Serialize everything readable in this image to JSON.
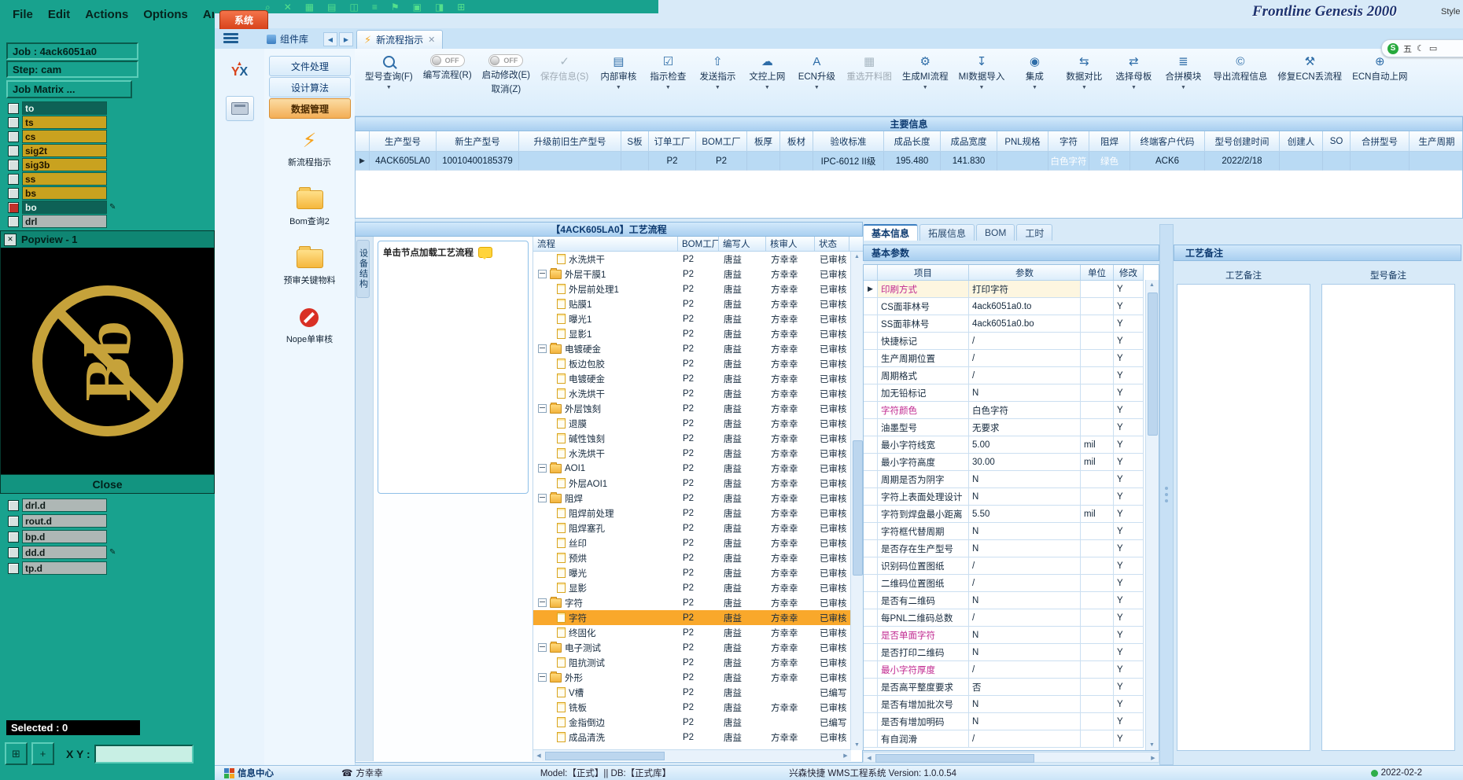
{
  "cam": {
    "menu": [
      "File",
      "Edit",
      "Actions",
      "Options",
      "Anal"
    ],
    "top_icons": [
      "zoom-icon",
      "close-icon",
      "grid-icon",
      "save-icon",
      "cells-icon",
      "list-icon",
      "flag-icon",
      "board-icon",
      "film-icon",
      "measure-icon"
    ],
    "job_label": "Job : 4ack6051a0",
    "step_label": "Step: cam",
    "job_matrix_label": "Job Matrix ...",
    "layers_top": [
      {
        "name": "to",
        "tone": "dark"
      },
      {
        "name": "ts",
        "tone": "gold"
      },
      {
        "name": "cs",
        "tone": "gold"
      },
      {
        "name": "sig2t",
        "tone": "gold"
      },
      {
        "name": "sig3b",
        "tone": "gold"
      },
      {
        "name": "ss",
        "tone": "gold"
      },
      {
        "name": "bs",
        "tone": "gold"
      },
      {
        "name": "bo",
        "tone": "dark",
        "marker": "red",
        "edited": true
      },
      {
        "name": "drl",
        "tone": "gray"
      }
    ],
    "layers_bottom": [
      {
        "name": "drl.d",
        "tone": "gray"
      },
      {
        "name": "rout.d",
        "tone": "gray"
      },
      {
        "name": "bp.d",
        "tone": "gray"
      },
      {
        "name": "dd.d",
        "tone": "gray",
        "edited": true
      },
      {
        "name": "tp.d",
        "tone": "gray"
      }
    ],
    "popview": {
      "title": "Popview - 1",
      "symbol_text": "Bb",
      "close_label": "Close"
    },
    "selected_label": "Selected : 0",
    "coord_label": "X Y :",
    "coord_value": ""
  },
  "desktop": {
    "genesis_title": "Frontline Genesis 2000",
    "style_label": "Style",
    "ime": {
      "logo_text": "S",
      "mode_text": "五"
    }
  },
  "app": {
    "system_tab": "系统",
    "tabbar": {
      "component_lib": "组件库",
      "active_tab": "新流程指示"
    },
    "sidebar": {
      "yx_logo_text": "YX",
      "buttons": [
        "文件处理",
        "设计算法",
        "数据管理"
      ],
      "active_index": 2,
      "shortcuts": [
        {
          "label": "新流程指示",
          "icon": "flow-bolt-icon"
        },
        {
          "label": "Bom查询2",
          "icon": "folder-icon"
        },
        {
          "label": "预审关键物料",
          "icon": "folder-icon"
        },
        {
          "label": "Nope单审核",
          "icon": "nope-audit-icon"
        }
      ]
    },
    "toolbar": {
      "buttons": [
        {
          "label": "型号查询(F)",
          "icon": "search-icon",
          "caret": true
        },
        {
          "label": "编写流程(R)",
          "icon": "toggle-off-switch",
          "toggle": "OFF"
        },
        {
          "label": "启动修改(E)",
          "sub": "取消(Z)",
          "icon": "toggle-off-switch",
          "toggle": "OFF"
        },
        {
          "label": "保存信息(S)",
          "icon": "save-check-icon",
          "disabled": true
        },
        {
          "label": "内部审核",
          "icon": "print-icon",
          "caret": true
        },
        {
          "label": "指示检查",
          "icon": "check-list-icon",
          "caret": true
        },
        {
          "label": "发送指示",
          "icon": "send-icon",
          "caret": true
        },
        {
          "label": "文控上网",
          "icon": "cloud-upload-icon",
          "caret": true
        },
        {
          "label": "ECN升级",
          "icon": "font-icon",
          "caret": true
        },
        {
          "label": "重选开料图",
          "icon": "image-icon",
          "disabled": true
        },
        {
          "label": "生成MI流程",
          "icon": "gears-icon",
          "caret": true
        },
        {
          "label": "MI数据导入",
          "icon": "import-icon",
          "caret": true
        },
        {
          "label": "集成",
          "icon": "integrate-icon",
          "caret": true
        },
        {
          "label": "数据对比",
          "icon": "compare-icon",
          "caret": true
        },
        {
          "label": "选择母板",
          "icon": "shuffle-icon",
          "caret": true
        },
        {
          "label": "合拼模块",
          "icon": "module-list-icon",
          "caret": true
        },
        {
          "label": "导出流程信息",
          "icon": "export-icon"
        },
        {
          "label": "修复ECN丢流程",
          "icon": "repair-icon"
        },
        {
          "label": "ECN自动上网",
          "icon": "auto-upload-icon"
        }
      ]
    },
    "main_info": {
      "title": "主要信息",
      "headers": [
        "生产型号",
        "新生产型号",
        "升级前旧生产型号",
        "S板",
        "订单工厂",
        "BOM工厂",
        "板厚",
        "板材",
        "验收标准",
        "成品长度",
        "成品宽度",
        "PNL规格",
        "字符",
        "阻焊",
        "终端客户代码",
        "型号创建时间",
        "创建人",
        "SO",
        "合拼型号",
        "生产周期"
      ],
      "row": [
        "4ACK605LA0",
        "10010400185379",
        "",
        "",
        "P2",
        "P2",
        "",
        "",
        "IPC-6012 II级",
        "195.480",
        "141.830",
        "",
        "白色字符",
        "绿色",
        "ACK6",
        "2022/2/18",
        "",
        "",
        "",
        ""
      ]
    },
    "flow": {
      "title": "【4ACK605LA0】工艺流程",
      "device_tab": "设备结构",
      "hint": "单击节点加载工艺流程",
      "headers": [
        "流程",
        "BOM工厂",
        "编写人",
        "核审人",
        "状态"
      ],
      "rows": [
        {
          "name": "水洗烘干",
          "type": "leaf",
          "bom": "P2",
          "writer": "唐益",
          "reviewer": "方幸幸",
          "status": "已审核"
        },
        {
          "name": "外层干膜1",
          "type": "folder",
          "bom": "P2",
          "writer": "唐益",
          "reviewer": "方幸幸",
          "status": "已审核"
        },
        {
          "name": "外层前处理1",
          "type": "leaf",
          "bom": "P2",
          "writer": "唐益",
          "reviewer": "方幸幸",
          "status": "已审核"
        },
        {
          "name": "贴膜1",
          "type": "leaf",
          "bom": "P2",
          "writer": "唐益",
          "reviewer": "方幸幸",
          "status": "已审核"
        },
        {
          "name": "曝光1",
          "type": "leaf",
          "bom": "P2",
          "writer": "唐益",
          "reviewer": "方幸幸",
          "status": "已审核"
        },
        {
          "name": "显影1",
          "type": "leaf",
          "bom": "P2",
          "writer": "唐益",
          "reviewer": "方幸幸",
          "status": "已审核"
        },
        {
          "name": "电镀硬金",
          "type": "folder",
          "bom": "P2",
          "writer": "唐益",
          "reviewer": "方幸幸",
          "status": "已审核"
        },
        {
          "name": "板边包胶",
          "type": "leaf",
          "bom": "P2",
          "writer": "唐益",
          "reviewer": "方幸幸",
          "status": "已审核"
        },
        {
          "name": "电镀硬金",
          "type": "leaf",
          "bom": "P2",
          "writer": "唐益",
          "reviewer": "方幸幸",
          "status": "已审核"
        },
        {
          "name": "水洗烘干",
          "type": "leaf",
          "bom": "P2",
          "writer": "唐益",
          "reviewer": "方幸幸",
          "status": "已审核"
        },
        {
          "name": "外层蚀刻",
          "type": "folder",
          "bom": "P2",
          "writer": "唐益",
          "reviewer": "方幸幸",
          "status": "已审核"
        },
        {
          "name": "退膜",
          "type": "leaf",
          "bom": "P2",
          "writer": "唐益",
          "reviewer": "方幸幸",
          "status": "已审核"
        },
        {
          "name": "碱性蚀刻",
          "type": "leaf",
          "bom": "P2",
          "writer": "唐益",
          "reviewer": "方幸幸",
          "status": "已审核"
        },
        {
          "name": "水洗烘干",
          "type": "leaf",
          "bom": "P2",
          "writer": "唐益",
          "reviewer": "方幸幸",
          "status": "已审核"
        },
        {
          "name": "AOI1",
          "type": "folder",
          "bom": "P2",
          "writer": "唐益",
          "reviewer": "方幸幸",
          "status": "已审核"
        },
        {
          "name": "外层AOI1",
          "type": "leaf",
          "bom": "P2",
          "writer": "唐益",
          "reviewer": "方幸幸",
          "status": "已审核"
        },
        {
          "name": "阻焊",
          "type": "folder",
          "bom": "P2",
          "writer": "唐益",
          "reviewer": "方幸幸",
          "status": "已审核"
        },
        {
          "name": "阻焊前处理",
          "type": "leaf",
          "bom": "P2",
          "writer": "唐益",
          "reviewer": "方幸幸",
          "status": "已审核"
        },
        {
          "name": "阻焊塞孔",
          "type": "leaf",
          "bom": "P2",
          "writer": "唐益",
          "reviewer": "方幸幸",
          "status": "已审核"
        },
        {
          "name": "丝印",
          "type": "leaf",
          "bom": "P2",
          "writer": "唐益",
          "reviewer": "方幸幸",
          "status": "已审核"
        },
        {
          "name": "预烘",
          "type": "leaf",
          "bom": "P2",
          "writer": "唐益",
          "reviewer": "方幸幸",
          "status": "已审核"
        },
        {
          "name": "曝光",
          "type": "leaf",
          "bom": "P2",
          "writer": "唐益",
          "reviewer": "方幸幸",
          "status": "已审核"
        },
        {
          "name": "显影",
          "type": "leaf",
          "bom": "P2",
          "writer": "唐益",
          "reviewer": "方幸幸",
          "status": "已审核"
        },
        {
          "name": "字符",
          "type": "folder",
          "bom": "P2",
          "writer": "唐益",
          "reviewer": "方幸幸",
          "status": "已审核"
        },
        {
          "name": "字符",
          "type": "leaf",
          "bom": "P2",
          "writer": "唐益",
          "reviewer": "方幸幸",
          "status": "已审核",
          "highlight": true
        },
        {
          "name": "终固化",
          "type": "leaf",
          "bom": "P2",
          "writer": "唐益",
          "reviewer": "方幸幸",
          "status": "已审核"
        },
        {
          "name": "电子测试",
          "type": "folder",
          "bom": "P2",
          "writer": "唐益",
          "reviewer": "方幸幸",
          "status": "已审核"
        },
        {
          "name": "阻抗测试",
          "type": "leaf",
          "bom": "P2",
          "writer": "唐益",
          "reviewer": "方幸幸",
          "status": "已审核"
        },
        {
          "name": "外形",
          "type": "folder",
          "bom": "P2",
          "writer": "唐益",
          "reviewer": "方幸幸",
          "status": "已审核"
        },
        {
          "name": "V槽",
          "type": "leaf",
          "bom": "P2",
          "writer": "唐益",
          "reviewer": "",
          "status": "已编写"
        },
        {
          "name": "铣板",
          "type": "leaf",
          "bom": "P2",
          "writer": "唐益",
          "reviewer": "方幸幸",
          "status": "已审核"
        },
        {
          "name": "金指倒边",
          "type": "leaf",
          "bom": "P2",
          "writer": "唐益",
          "reviewer": "",
          "status": "已编写"
        },
        {
          "name": "成品清洗",
          "type": "leaf",
          "bom": "P2",
          "writer": "唐益",
          "reviewer": "方幸幸",
          "status": "已审核"
        }
      ]
    },
    "params": {
      "tabs": [
        "基本信息",
        "拓展信息",
        "BOM",
        "工时"
      ],
      "active_tab_index": 0,
      "section": "基本参数",
      "headers": [
        "项目",
        "参数",
        "单位",
        "修改"
      ],
      "rows": [
        {
          "item": "印刷方式",
          "value": "打印字符",
          "unit": "",
          "flag": "Y",
          "accent": true,
          "selected": true
        },
        {
          "item": "CS面菲林号",
          "value": "4ack6051a0.to",
          "unit": "",
          "flag": "Y"
        },
        {
          "item": "SS面菲林号",
          "value": "4ack6051a0.bo",
          "unit": "",
          "flag": "Y"
        },
        {
          "item": "快捷标记",
          "value": "/",
          "unit": "",
          "flag": "Y"
        },
        {
          "item": "生产周期位置",
          "value": "/",
          "unit": "",
          "flag": "Y"
        },
        {
          "item": "周期格式",
          "value": "/",
          "unit": "",
          "flag": "Y"
        },
        {
          "item": "加无铅标记",
          "value": "N",
          "unit": "",
          "flag": "Y"
        },
        {
          "item": "字符颜色",
          "value": "白色字符",
          "unit": "",
          "flag": "Y",
          "accent": true
        },
        {
          "item": "油墨型号",
          "value": "无要求",
          "unit": "",
          "flag": "Y"
        },
        {
          "item": "最小字符线宽",
          "value": "5.00",
          "unit": "mil",
          "flag": "Y"
        },
        {
          "item": "最小字符高度",
          "value": "30.00",
          "unit": "mil",
          "flag": "Y"
        },
        {
          "item": "周期是否为阴字",
          "value": "N",
          "unit": "",
          "flag": "Y"
        },
        {
          "item": "字符上表面处理设计",
          "value": "N",
          "unit": "",
          "flag": "Y"
        },
        {
          "item": "字符到焊盘最小距离",
          "value": "5.50",
          "unit": "mil",
          "flag": "Y"
        },
        {
          "item": "字符框代替周期",
          "value": "N",
          "unit": "",
          "flag": "Y"
        },
        {
          "item": "是否存在生产型号",
          "value": "N",
          "unit": "",
          "flag": "Y"
        },
        {
          "item": "识别码位置图纸",
          "value": "/",
          "unit": "",
          "flag": "Y"
        },
        {
          "item": "二维码位置图纸",
          "value": "/",
          "unit": "",
          "flag": "Y"
        },
        {
          "item": "是否有二维码",
          "value": "N",
          "unit": "",
          "flag": "Y"
        },
        {
          "item": "每PNL二维码总数",
          "value": "/",
          "unit": "",
          "flag": "Y"
        },
        {
          "item": "是否单面字符",
          "value": "N",
          "unit": "",
          "flag": "Y",
          "accent": true
        },
        {
          "item": "是否打印二维码",
          "value": "N",
          "unit": "",
          "flag": "Y"
        },
        {
          "item": "最小字符厚度",
          "value": "/",
          "unit": "",
          "flag": "Y",
          "accent": true
        },
        {
          "item": "是否高平整度要求",
          "value": "否",
          "unit": "",
          "flag": "Y"
        },
        {
          "item": "是否有增加批次号",
          "value": "N",
          "unit": "",
          "flag": "Y"
        },
        {
          "item": "是否有增加明码",
          "value": "N",
          "unit": "",
          "flag": "Y"
        },
        {
          "item": "有自润滑",
          "value": "/",
          "unit": "",
          "flag": "Y"
        }
      ]
    },
    "remarks": {
      "title": "工艺备注",
      "columns": [
        "工艺备注",
        "型号备注"
      ]
    },
    "statusbar": {
      "info_center": "信息中心",
      "user": "方幸幸",
      "model_db": "Model:【正式】|| DB:【正式库】",
      "version_text": "兴森快捷  WMS工程系统  Version: 1.0.0.54",
      "date": "2022-02-2"
    }
  }
}
